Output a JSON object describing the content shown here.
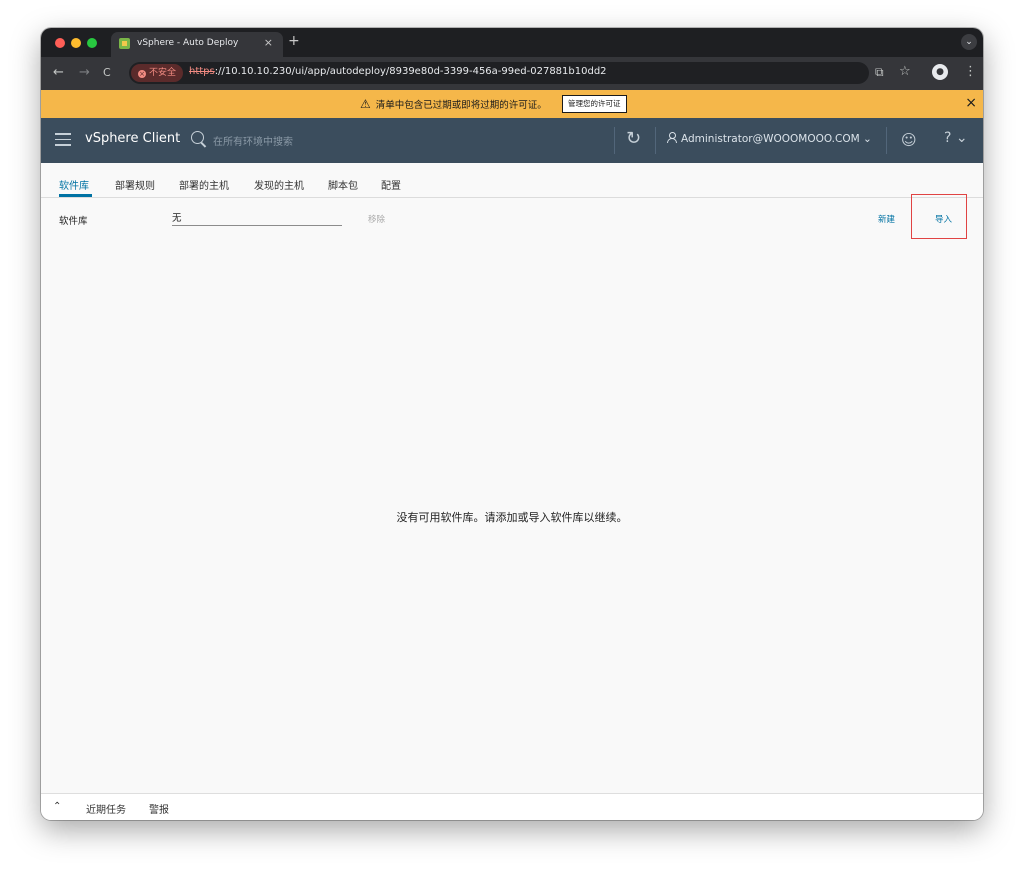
{
  "browser": {
    "tab_title": "vSphere - Auto Deploy",
    "tab_close": "×",
    "new_tab": "+",
    "tab_menu": "⌄",
    "back": "←",
    "forward": "→",
    "reload": "C",
    "security_label": "不安全",
    "url_scheme": "https",
    "url_rest": "://10.10.10.230/ui/app/autodeploy/8939e80d-3399-456a-99ed-027881b10dd2",
    "translate_icon": "⧉",
    "bookmark_icon": "☆",
    "menu_icon": "⋮",
    "traffic_lights": [
      "#ff5f57",
      "#febc2e",
      "#28c840"
    ]
  },
  "banner": {
    "warning_icon": "⚠",
    "message": "清单中包含已过期或即将过期的许可证。",
    "button_label": "管理您的许可证",
    "close": "×",
    "color": "#f5b74a"
  },
  "header": {
    "brand": "vSphere Client",
    "search_placeholder": "在所有环境中搜索",
    "refresh_icon": "↻",
    "user": "Administrator@WOOOMOOO.COM ⌄",
    "smiley_icon": "☺",
    "help_icon": "? ⌄",
    "color": "#3b4d5d"
  },
  "tabs": [
    {
      "label": "软件库",
      "active": true
    },
    {
      "label": "部署规则",
      "active": false
    },
    {
      "label": "部署的主机",
      "active": false
    },
    {
      "label": "发现的主机",
      "active": false
    },
    {
      "label": "脚本包",
      "active": false
    },
    {
      "label": "配置",
      "active": false
    }
  ],
  "content": {
    "library_label": "软件库",
    "library_value": "无",
    "remove_label": "移除",
    "new_label": "新建",
    "import_label": "导入",
    "empty_message": "没有可用软件库。请添加或导入软件库以继续。",
    "accent": "#0072a3"
  },
  "footer": {
    "chevron": "⌃",
    "recent_tasks": "近期任务",
    "alarms": "警报"
  }
}
